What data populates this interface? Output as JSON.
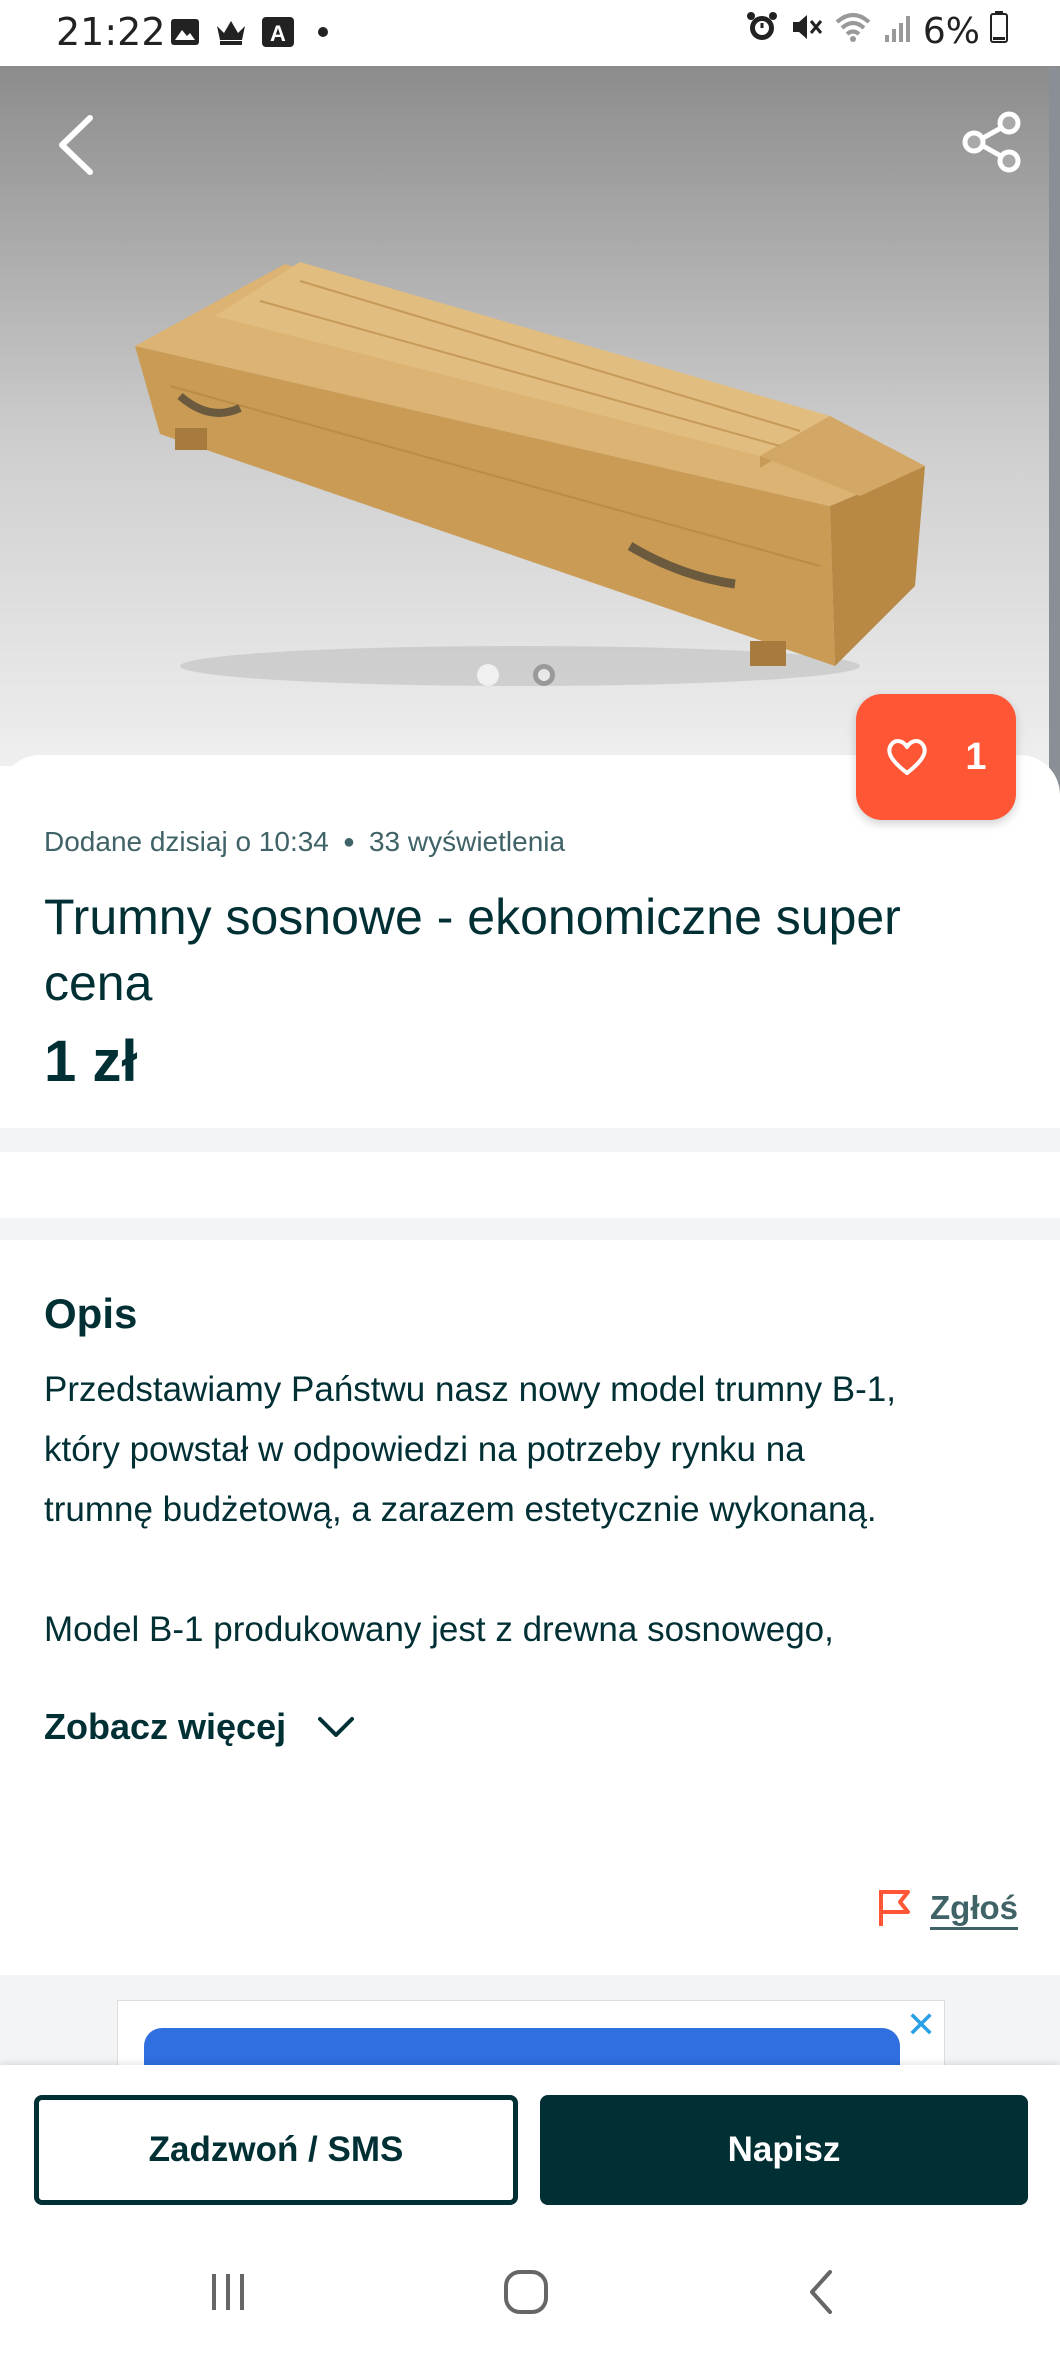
{
  "status_bar": {
    "time": "21:22",
    "battery": "6%",
    "left_icons": [
      "gallery-icon",
      "crown-icon",
      "a-app-icon",
      "dot-icon"
    ],
    "right_icons": [
      "alarm-icon",
      "mute-icon",
      "wifi-icon",
      "signal-icon",
      "battery-icon"
    ]
  },
  "gallery": {
    "image": "pine-coffin-photo",
    "slide_count": 2,
    "active_slide": 1
  },
  "favorite": {
    "count": "1"
  },
  "listing": {
    "added": "Dodane dzisiaj o 10:34",
    "views": "33 wyświetlenia",
    "title": "Trumny sosnowe - ekonomiczne super cena",
    "price": "1 zł"
  },
  "description": {
    "heading": "Opis",
    "text": "Przedstawiamy Państwu nasz nowy model trumny B-1,\nktóry powstał w odpowiedzi na potrzeby rynku na\ntrumnę budżetową, a zarazem estetycznie wykonaną.\n\nModel B-1 produkowany jest z drewna sosnowego,",
    "see_more": "Zobacz więcej"
  },
  "report": {
    "label": "Zgłoś"
  },
  "actions": {
    "call_label": "Zadzwoń / SMS",
    "write_label": "Napisz"
  },
  "colors": {
    "primary": "#002f34",
    "accent": "#ff5636",
    "muted": "#406367",
    "section_gap": "#f2f4f5"
  }
}
